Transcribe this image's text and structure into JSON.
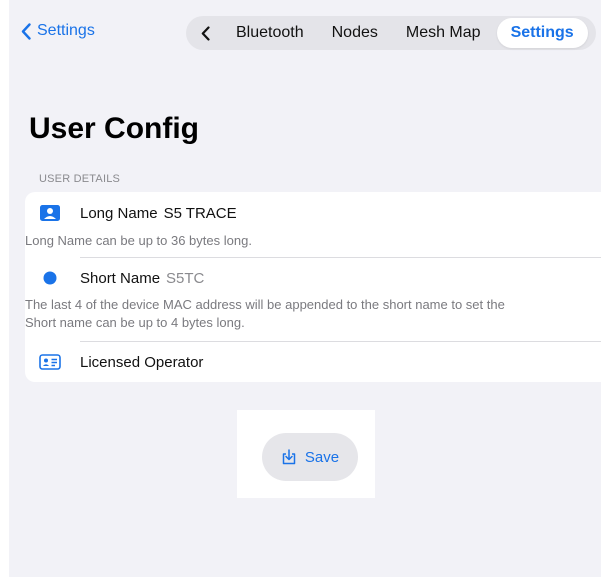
{
  "nav": {
    "back_label": "Settings",
    "tabs": [
      {
        "label": "Bluetooth",
        "active": false
      },
      {
        "label": "Nodes",
        "active": false
      },
      {
        "label": "Mesh Map",
        "active": false
      },
      {
        "label": "Settings",
        "active": true
      }
    ]
  },
  "page": {
    "title": "User Config"
  },
  "user_details": {
    "section_header": "USER DETAILS",
    "long_name": {
      "label": "Long Name",
      "value": "S5 TRACE",
      "description": "Long Name can be up to 36 bytes long.",
      "icon": "person-crop-square-icon"
    },
    "short_name": {
      "label": "Short Name",
      "value": "S5TC",
      "description_line1": "The last 4 of the device MAC address will be appended to the short name to set the",
      "description_line2": "Short name can be up to 4 bytes long.",
      "icon": "circle-icon"
    },
    "licensed_operator": {
      "label": "Licensed Operator",
      "icon": "id-card-icon"
    }
  },
  "actions": {
    "save_label": "Save",
    "save_icon": "save-tray-icon"
  },
  "colors": {
    "accent": "#1a73e8",
    "background": "#f2f2f7",
    "card": "#ffffff",
    "secondary_text": "#7a7a7f"
  }
}
